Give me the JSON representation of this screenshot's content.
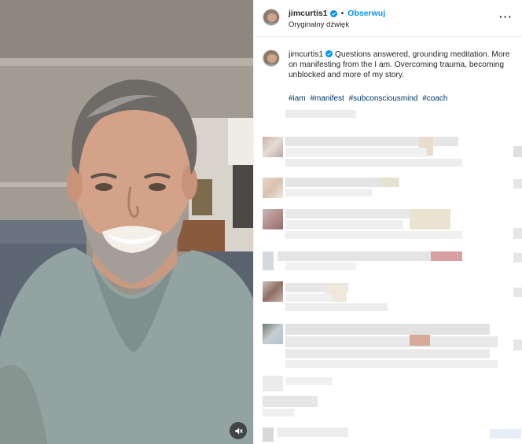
{
  "post": {
    "username": "jimcurtis1",
    "follow_label": "Obserwuj",
    "audio_label": "Oryginalny dźwięk",
    "more_label": "···",
    "caption": "Questions answered, grounding meditation. More on manifesting from the I am. Overcoming trauma, becoming unblocked and more of my story.",
    "hashtags": [
      "#iam",
      "#manifest",
      "#subconsciousmind",
      "#coach"
    ]
  },
  "colors": {
    "accent": "#0095f6",
    "hashtag": "#00376b",
    "verified": "#0095f6",
    "shirt": "#93a3a1"
  },
  "icons": {
    "verified": "verified-badge-icon",
    "mute": "speaker-muted-icon"
  }
}
